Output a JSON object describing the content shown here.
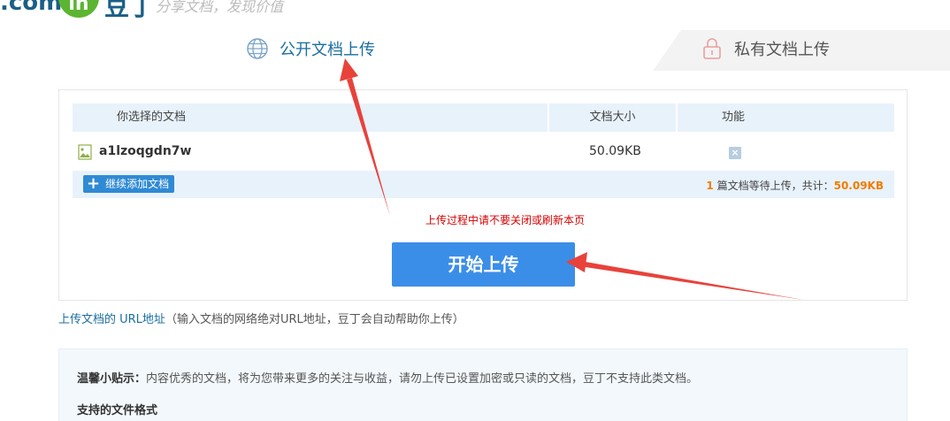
{
  "header": {
    "logo_text": ".com",
    "logo_badge": "ln",
    "logo_cn": "豆丁",
    "slogan": "分享文档，发现价值"
  },
  "tabs": {
    "public": {
      "label": "公开文档上传",
      "icon": "globe-icon"
    },
    "private": {
      "label": "私有文档上传",
      "icon": "lock-icon"
    }
  },
  "table": {
    "headers": {
      "name": "你选择的文档",
      "size": "文档大小",
      "func": "功能"
    },
    "rows": [
      {
        "name": "a1lzoqgdn7w",
        "size": "50.09KB",
        "delete": "×"
      }
    ]
  },
  "footer": {
    "add_label": "继续添加文档",
    "count": "1",
    "summary_mid": " 篇文档等待上传，共计：",
    "total": "50.09KB"
  },
  "warning": "上传过程中请不要关闭或刷新本页",
  "start_label": "开始上传",
  "url_link": "上传文档的 URL地址",
  "url_hint": "（输入文档的网络绝对URL地址，豆丁会自动帮助你上传）",
  "tips": {
    "lead": "温馨小贴示：",
    "text": "内容优秀的文档，将为您带来更多的关注与收益，请勿上传已设置加密或只读的文档，豆丁不支持此类文档。",
    "formats_title": "支持的文件格式"
  },
  "colors": {
    "accent": "#3b8ee8",
    "header_bg": "#e8f2fb",
    "warning": "#d40000",
    "highlight": "#f07d00",
    "arrow": "#e8423b"
  }
}
